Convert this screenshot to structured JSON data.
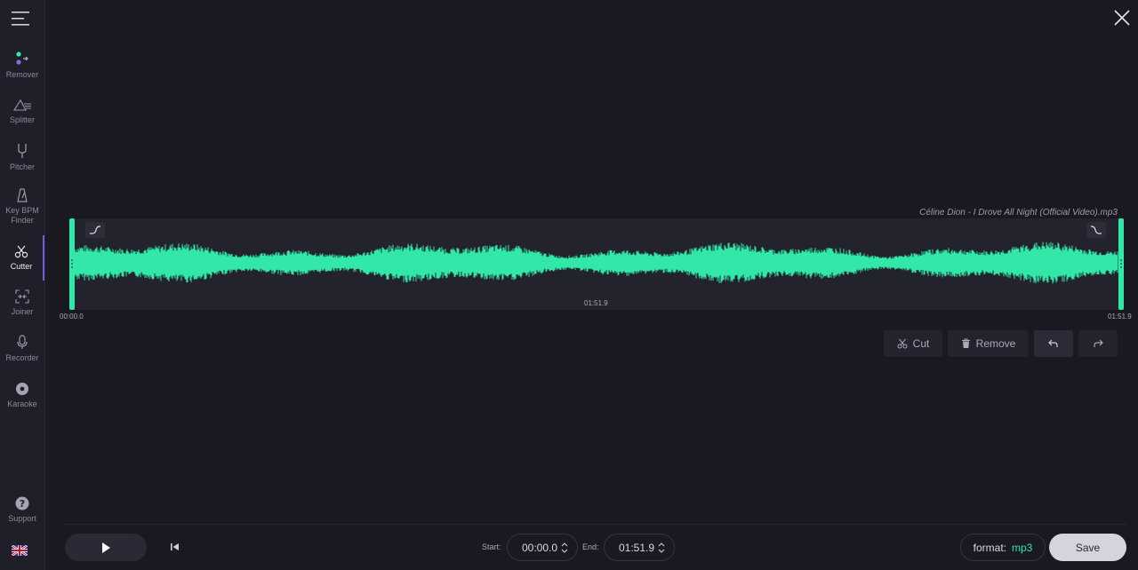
{
  "sidebar": {
    "items": [
      {
        "label": "Remover",
        "icon": "remover-icon"
      },
      {
        "label": "Splitter",
        "icon": "splitter-icon"
      },
      {
        "label": "Pitcher",
        "icon": "tuning-fork-icon"
      },
      {
        "label": "Key BPM\nFinder",
        "icon": "metronome-icon"
      },
      {
        "label": "Cutter",
        "icon": "scissors-icon",
        "active": true
      },
      {
        "label": "Joiner",
        "icon": "joiner-icon"
      },
      {
        "label": "Recorder",
        "icon": "microphone-icon"
      },
      {
        "label": "Karaoke",
        "icon": "disc-icon"
      }
    ],
    "support_label": "Support",
    "language_flag": "uk-flag-icon"
  },
  "editor": {
    "file_name": "Céline Dion - I Drove All Night (Official Video).mp3",
    "start_marker": "00:00.0",
    "center_marker": "01:51.9",
    "end_marker": "01:51.9",
    "waveform_color": "#31e8a8"
  },
  "actions": {
    "cut_label": "Cut",
    "remove_label": "Remove"
  },
  "player": {
    "start_label": "Start:",
    "start_value": "00:00.0",
    "end_label": "End:",
    "end_value": "01:51.9",
    "format_label": "format:",
    "format_value": "mp3",
    "save_label": "Save"
  },
  "colors": {
    "accent": "#31e8a8",
    "active_indicator": "#6f5fd6",
    "background": "#191921"
  }
}
